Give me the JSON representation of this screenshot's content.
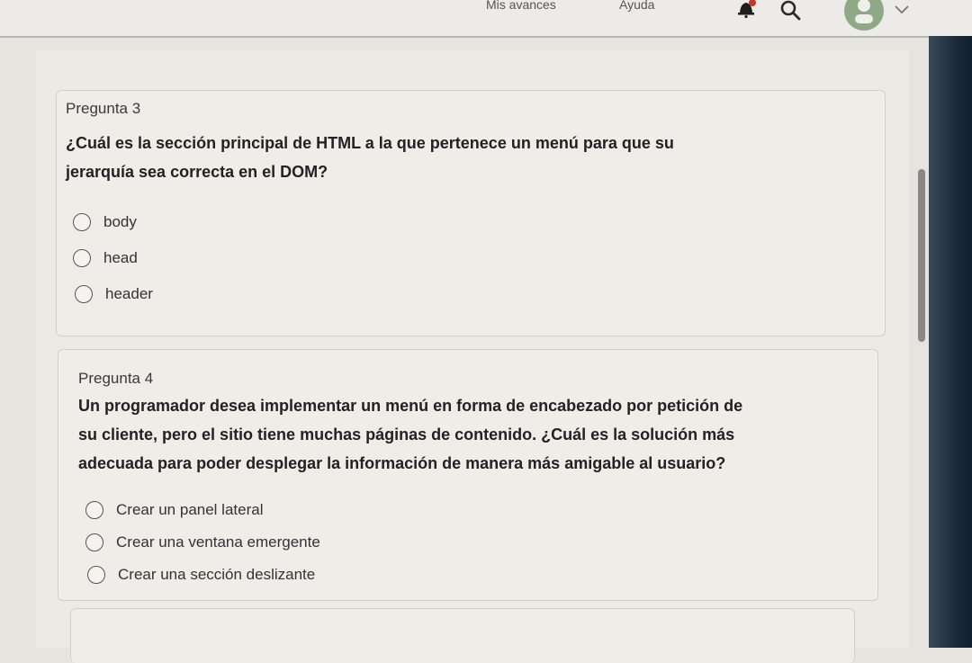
{
  "topbar": {
    "progress_link": "Mis avances",
    "help_link": "Ayuda",
    "icons": [
      "bell-icon",
      "search-icon",
      "avatar",
      "chevron-down-icon"
    ]
  },
  "questions": [
    {
      "number": "Pregunta 3",
      "text_lines": [
        "¿Cuál es la sección principal de HTML a la que pertenece un menú para que su",
        "jerarquía sea correcta en el DOM?"
      ],
      "options": [
        "body",
        "head",
        "header"
      ]
    },
    {
      "number": "Pregunta 4",
      "text_lines": [
        "Un programador desea implementar un menú en forma de encabezado por petición de",
        "su cliente, pero el sitio tiene muchas páginas de contenido. ¿Cuál es la solución más",
        "adecuada para poder desplegar la información de manera más amigable al usuario?"
      ],
      "options": [
        "Crear un panel lateral",
        "Crear una ventana emergente",
        "Crear una sección deslizante"
      ]
    }
  ],
  "colors": {
    "background": "#e6e4df",
    "card": "#efede8",
    "bell_accent": "#c0392b",
    "avatar": "#8fa888"
  }
}
